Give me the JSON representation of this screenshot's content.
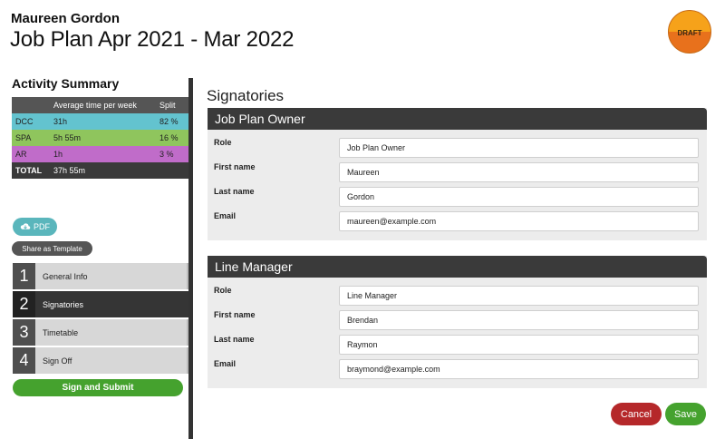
{
  "header": {
    "name": "Maureen Gordon",
    "title": "Job Plan Apr 2021 - Mar 2022",
    "badge": "DRAFT"
  },
  "summary": {
    "title": "Activity Summary",
    "columns": [
      "",
      "Average time per week",
      "Split"
    ],
    "rows": [
      {
        "code": "DCC",
        "time": "31h",
        "split": "82 %",
        "color": "#63c3cf"
      },
      {
        "code": "SPA",
        "time": "5h 55m",
        "split": "16 %",
        "color": "#8fc55d"
      },
      {
        "code": "AR",
        "time": "1h",
        "split": "3 %",
        "color": "#c06cc9"
      }
    ],
    "total": {
      "label": "TOTAL",
      "time": "37h 55m"
    }
  },
  "actions": {
    "pdf_label": "PDF",
    "template_label": "Share as Template",
    "submit_label": "Sign and Submit"
  },
  "steps": [
    {
      "num": "1",
      "label": "General Info",
      "active": false
    },
    {
      "num": "2",
      "label": "Signatories",
      "active": true
    },
    {
      "num": "3",
      "label": "Timetable",
      "active": false
    },
    {
      "num": "4",
      "label": "Sign Off",
      "active": false
    }
  ],
  "panel": {
    "title": "Signatories",
    "owner": {
      "header": "Job Plan Owner",
      "labels": {
        "role": "Role",
        "first": "First name",
        "last": "Last name",
        "email": "Email"
      },
      "values": {
        "role": "Job Plan Owner",
        "first": "Maureen",
        "last": "Gordon",
        "email": "maureen@example.com"
      }
    },
    "manager": {
      "header": "Line Manager",
      "labels": {
        "role": "Role",
        "first": "First name",
        "last": "Last name",
        "email": "Email"
      },
      "values": {
        "role": "Line Manager",
        "first": "Brendan",
        "last": "Raymon",
        "email": "braymond@example.com"
      }
    },
    "cancel_label": "Cancel",
    "save_label": "Save"
  },
  "colors": {
    "accent_green": "#45a22e",
    "cancel_red": "#b5282a",
    "dark": "#353535"
  },
  "icons": {
    "pdf": "cloud-download-icon",
    "badge": "draft-badge"
  }
}
